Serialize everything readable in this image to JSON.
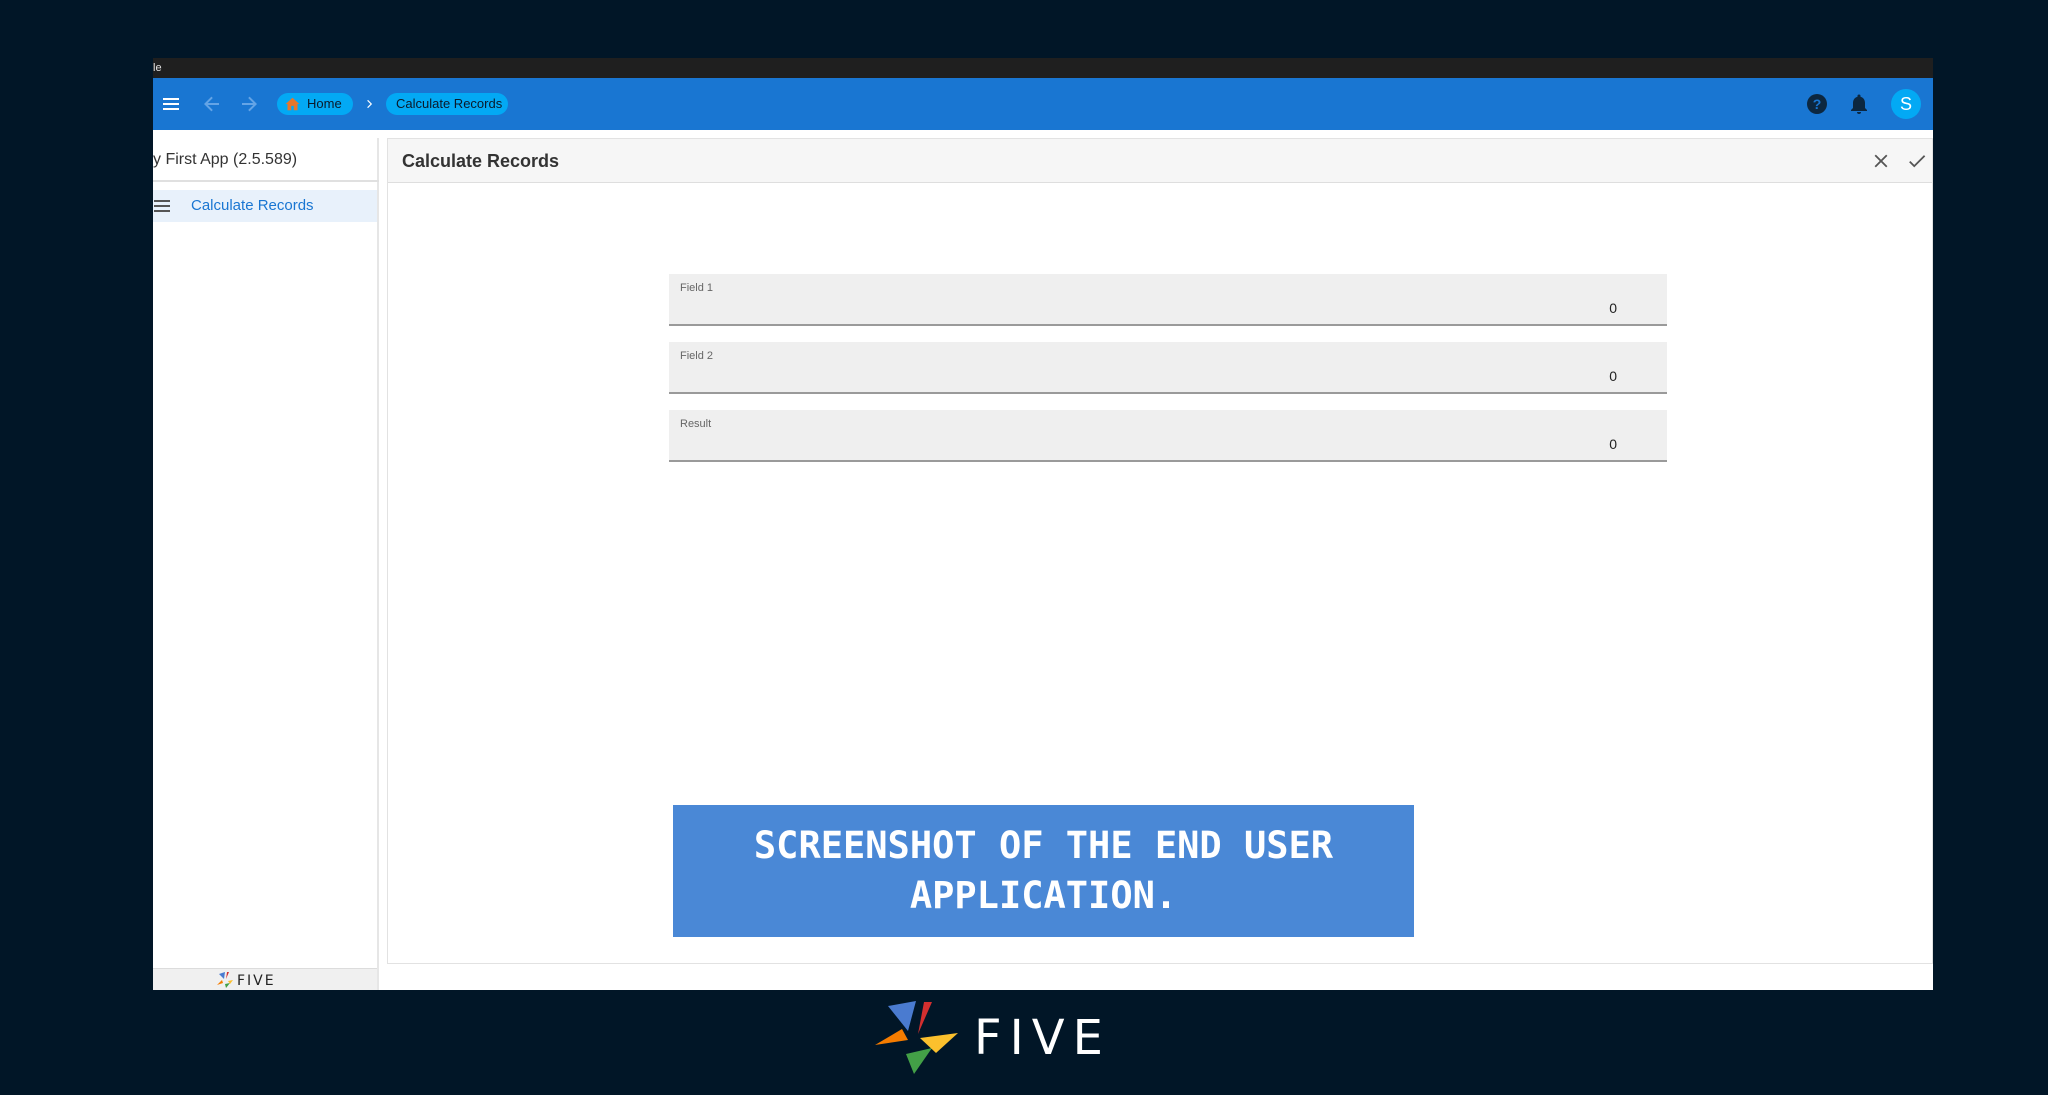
{
  "window": {
    "titlebar_text": "le"
  },
  "topbar": {
    "menu_icon": "menu-icon",
    "back_icon": "arrow-back-icon",
    "forward_icon": "arrow-forward-icon",
    "breadcrumbs": [
      {
        "label": "Home",
        "icon": "home-icon"
      },
      {
        "label": "Calculate Records"
      }
    ],
    "help_icon": "help-icon",
    "notifications_icon": "bell-icon",
    "avatar_letter": "S"
  },
  "sidebar": {
    "app_title": "y First App (2.5.589)",
    "items": [
      {
        "label": "Calculate Records",
        "icon": "list-icon"
      }
    ],
    "footer_logo": "FIVE"
  },
  "main": {
    "title": "Calculate Records",
    "close_icon": "close-icon",
    "save_icon": "check-icon",
    "fields": [
      {
        "label": "Field 1",
        "value": "0"
      },
      {
        "label": "Field 2",
        "value": "0"
      },
      {
        "label": "Result",
        "value": "0"
      }
    ]
  },
  "banner": {
    "line1": "SCREENSHOT OF THE END USER",
    "line2": "APPLICATION."
  },
  "brand": {
    "logo_text": "FIVE"
  },
  "colors": {
    "background": "#011627",
    "topbar": "#1976d2",
    "crumb": "#03a9f4",
    "banner": "#4a88d6",
    "accent_text": "#1976d2"
  }
}
